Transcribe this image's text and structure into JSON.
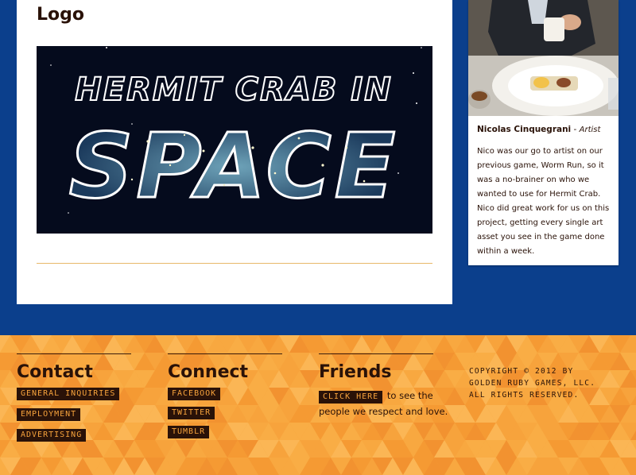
{
  "main": {
    "section_title": "Logo",
    "logo": {
      "line1": "HERMIT CRAB IN",
      "line2": "SPACE",
      "background_color": "#050b1d",
      "text_color": "#1b3a5c"
    }
  },
  "sidebar": {
    "person": {
      "name": "Nicolas Cinquegrani",
      "separator": " - ",
      "role": "Artist",
      "bio": "Nico was our go to artist on our previous game, Worm Run, so it was a no-brainer on who we wanted to use for Hermit Crab. Nico did great work for us on this project, getting every single art asset you see in the game done within a week."
    }
  },
  "footer": {
    "contact": {
      "title": "Contact",
      "links": [
        "GENERAL INQUIRIES",
        "EMPLOYMENT",
        "ADVERTISING"
      ]
    },
    "connect": {
      "title": "Connect",
      "links": [
        "FACEBOOK",
        "TWITTER",
        "TUMBLR"
      ]
    },
    "friends": {
      "title": "Friends",
      "link_label": "CLICK HERE",
      "text": " to see the people we respect and love."
    },
    "copyright": "COPYRIGHT © 2012 BY GOLDEN RUBY GAMES, LLC. ALL RIGHTS RESERVED."
  },
  "colors": {
    "page_background": "#0b3f8c",
    "footer_orange": "#f7a33c",
    "dark_brown": "#2a1208",
    "divider": "#e8b86a"
  }
}
